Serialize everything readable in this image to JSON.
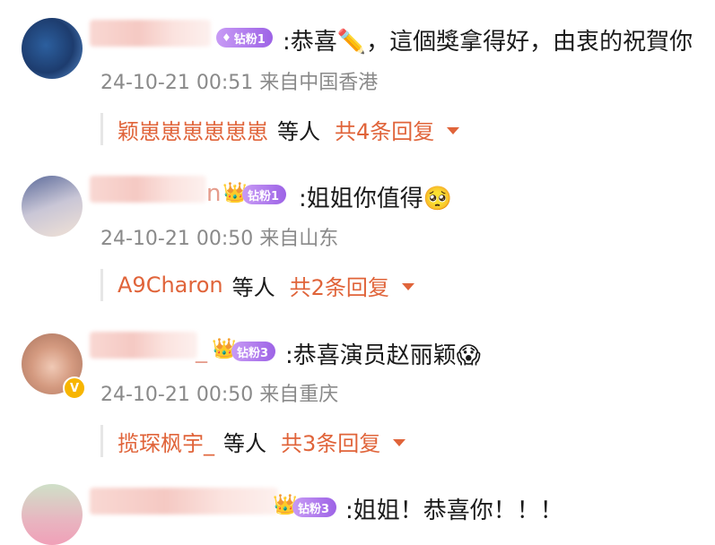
{
  "comments": [
    {
      "badge": "钻粉1",
      "text": ":恭喜✏️，這個獎拿得好，由衷的祝賀你",
      "meta": "24-10-21 00:51 来自中国香港",
      "reply_user": "颖崽崽崽崽崽崽",
      "reply_etc": "等人",
      "reply_count": "共4条回复"
    },
    {
      "name_suffix": "n",
      "badge": "钻粉1",
      "text": ":姐姐你值得",
      "meta": "24-10-21 00:50 来自山东",
      "reply_user": "A9Charon",
      "reply_etc": "等人",
      "reply_count": "共2条回复"
    },
    {
      "name_suffix": "_",
      "badge": "钻粉3",
      "text": ":恭喜演员赵丽颖",
      "meta": "24-10-21 00:50 来自重庆",
      "reply_user": "揽琛枫宇_",
      "reply_etc": "等人",
      "reply_count": "共3条回复"
    },
    {
      "badge": "钻粉3",
      "text": ":姐姐！恭喜你！！！"
    }
  ],
  "icons": {
    "badge_gem": "diamond-icon",
    "crown": "crown-icon",
    "verified": "verified-v-icon",
    "expand": "caret-down-icon"
  },
  "colors": {
    "accent": "#e0643a",
    "badge_purple": "#a86ce8",
    "meta_gray": "#8a8a8a"
  },
  "verified_mark": "V",
  "emoji": {
    "pleading": "🥺",
    "scream": "😱"
  }
}
